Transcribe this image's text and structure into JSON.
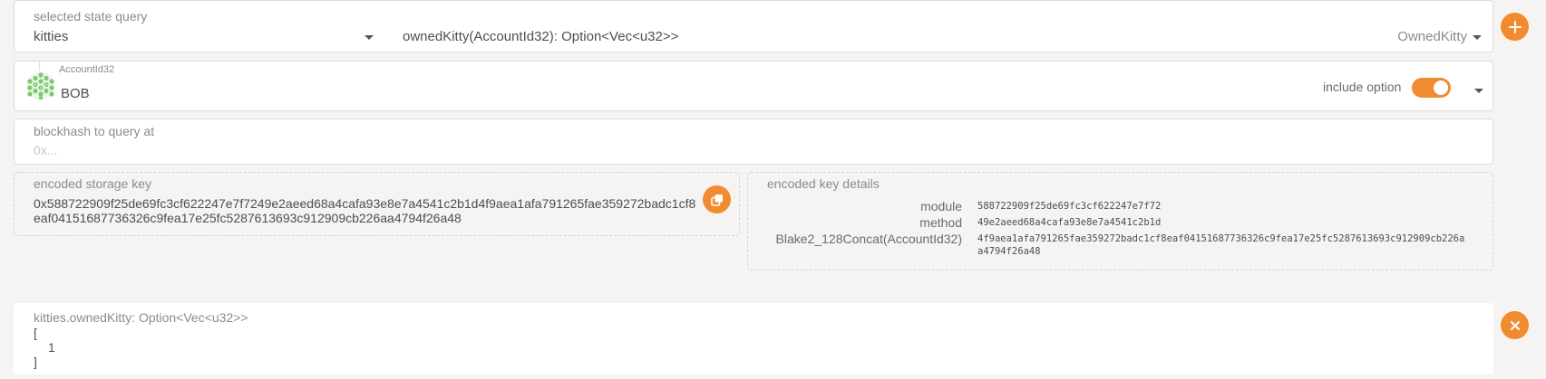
{
  "query_row": {
    "label": "selected state query",
    "module_value": "kitties",
    "method_value": "ownedKitty(AccountId32): Option<Vec<u32>>",
    "type_value": "OwnedKitty",
    "add_icon": "plus-icon"
  },
  "account": {
    "label": "AccountId32",
    "value": "BOB",
    "include_option_label": "include option",
    "include_option_on": true
  },
  "blockhash": {
    "label": "blockhash to query at",
    "placeholder": "0x..."
  },
  "encoded_storage_key": {
    "label": "encoded storage key",
    "value_line1": "0x588722909f25de69fc3cf622247e7f7249e2aeed68a4cafa93e8e7a4541c2b1d4f9aea1afa791265fae359272badc1cf8",
    "value_line2": "eaf04151687736326c9fea17e25fc5287613693c912909cb226aa4794f26a48",
    "copy_icon": "copy-icon"
  },
  "encoded_key_details": {
    "label": "encoded key details",
    "rows": [
      {
        "key": "module",
        "value": "588722909f25de69fc3cf622247e7f72"
      },
      {
        "key": "method",
        "value": "49e2aeed68a4cafa93e8e7a4541c2b1d"
      },
      {
        "key": "Blake2_128Concat(AccountId32)",
        "value": "4f9aea1afa791265fae359272badc1cf8eaf04151687736326c9fea17e25fc5287613693c912909cb226a a4794f26a48"
      }
    ]
  },
  "result": {
    "label": "kitties.ownedKitty: Option<Vec<u32>>",
    "line1": "[",
    "line2": "1",
    "line3": "]",
    "close_icon": "close-icon"
  }
}
